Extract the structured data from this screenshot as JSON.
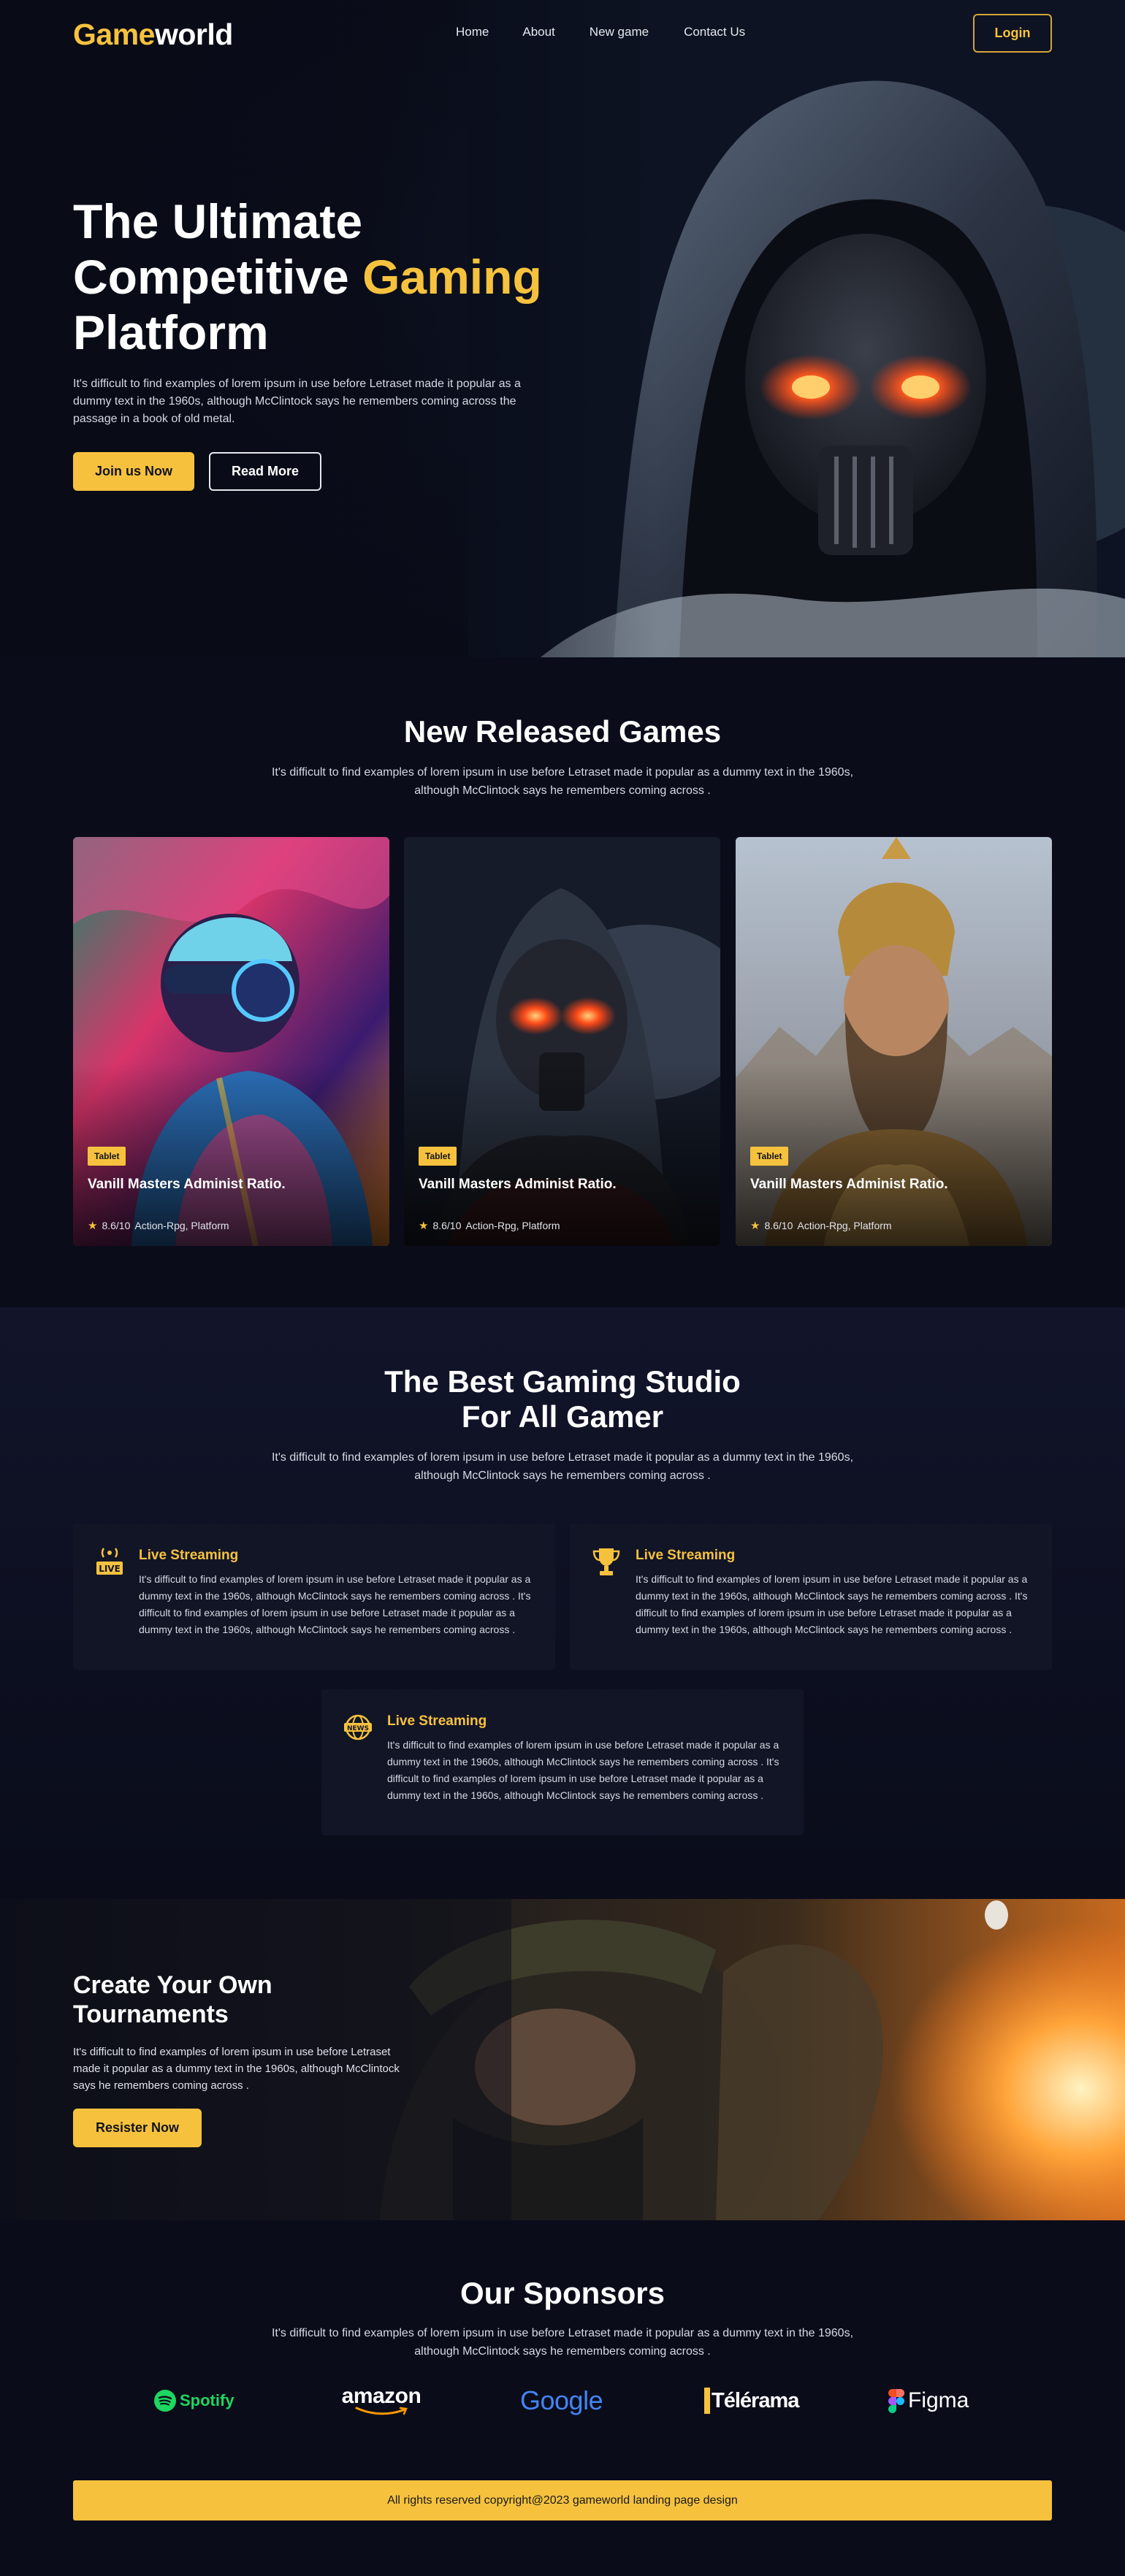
{
  "brand": {
    "part1": "Game",
    "part2": "world"
  },
  "nav": {
    "links": [
      "Home",
      "About",
      "New game",
      "Contact Us"
    ],
    "login": "Login"
  },
  "hero": {
    "title_line1": "The Ultimate",
    "title_line2a": "Competitive ",
    "title_line2b": "Gaming",
    "title_line3": "Platform",
    "description": "It's difficult to find examples of lorem ipsum in use before Letraset made it popular as a dummy text in the 1960s, although McClintock says he remembers coming across the passage in a book of old metal.",
    "primary_button": "Join us Now",
    "secondary_button": "Read More"
  },
  "new_games": {
    "title": "New Released Games",
    "subtitle": "It's difficult to find examples of lorem ipsum in use before Letraset made it popular as a dummy text in the 1960s, although McClintock says he remembers coming across .",
    "cards": [
      {
        "tag": "Tablet",
        "title": "Vanill Masters Administ Ratio.",
        "rating": "8.6/10",
        "genre": "Action-Rpg, Platform"
      },
      {
        "tag": "Tablet",
        "title": "Vanill Masters Administ Ratio.",
        "rating": "8.6/10",
        "genre": "Action-Rpg, Platform"
      },
      {
        "tag": "Tablet",
        "title": "Vanill Masters Administ Ratio.",
        "rating": "8.6/10",
        "genre": "Action-Rpg, Platform"
      }
    ]
  },
  "studio": {
    "title_line1": "The Best Gaming Studio",
    "title_line2": "For All Gamer",
    "subtitle": "It's difficult to find examples of lorem ipsum in use before Letraset made it popular as a dummy text in the 1960s, although McClintock says he remembers coming across .",
    "features": [
      {
        "icon": "live-icon",
        "icon_text": "LIVE",
        "title": "Live Streaming",
        "description": "It's difficult to find examples of lorem ipsum in use before Letraset made it popular as a dummy text in the 1960s, although McClintock says he remembers coming across . It's difficult to find examples of lorem ipsum in use before Letraset made it popular as a dummy text in the 1960s, although McClintock says he remembers coming across ."
      },
      {
        "icon": "trophy-icon",
        "title": "Live Streaming",
        "description": "It's difficult to find examples of lorem ipsum in use before Letraset made it popular as a dummy text in the 1960s, although McClintock says he remembers coming across . It's difficult to find examples of lorem ipsum in use before Letraset made it popular as a dummy text in the 1960s, although McClintock says he remembers coming across ."
      },
      {
        "icon": "news-icon",
        "icon_text": "NEWS",
        "title": "Live Streaming",
        "description": "It's difficult to find examples of lorem ipsum in use before Letraset made it popular as a dummy text in the 1960s, although McClintock says he remembers coming across . It's difficult to find examples of lorem ipsum in use before Letraset made it popular as a dummy text in the 1960s, although McClintock says he remembers coming across ."
      }
    ]
  },
  "tournament": {
    "title": "Create Your Own Tournaments",
    "description": "It's difficult to find examples of lorem ipsum in use before Letraset made it popular as a dummy text in the 1960s, although McClintock says he remembers coming across .",
    "button": "Resister Now"
  },
  "sponsors": {
    "title": "Our Sponsors",
    "subtitle": "It's difficult to find examples of lorem ipsum in use before Letraset made it popular as a dummy text in the 1960s, although McClintock says he remembers coming across .",
    "logos": [
      "Spotify",
      "amazon",
      "Google",
      "Télérama",
      "Figma"
    ]
  },
  "footer": {
    "copyright": "All rights reserved copyright@2023 gameworld landing page design"
  },
  "colors": {
    "accent": "#f6c23e",
    "background": "#0a0c1a",
    "panel": "#121526"
  }
}
